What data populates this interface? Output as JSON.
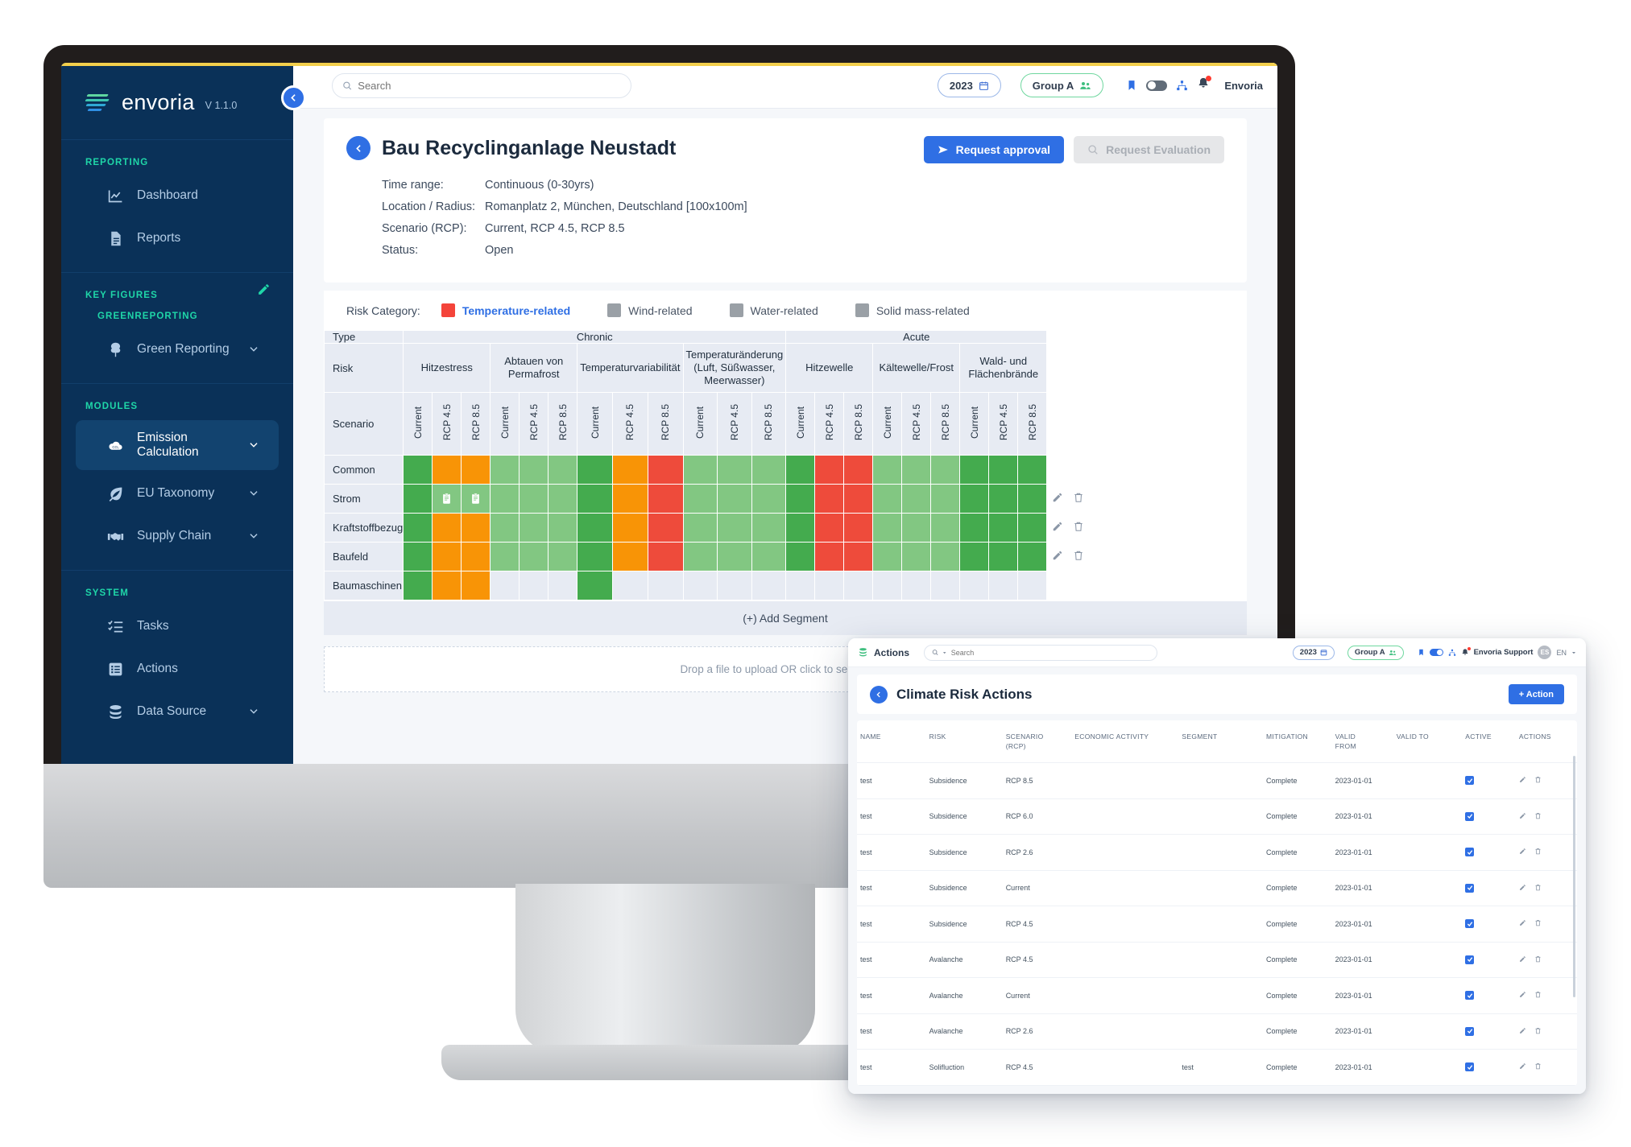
{
  "brand": {
    "name": "envoria",
    "version": "V 1.1.0"
  },
  "sidebar": {
    "groups": [
      {
        "label": "REPORTING",
        "items": [
          {
            "label": "Dashboard",
            "icon": "chart-line-icon"
          },
          {
            "label": "Reports",
            "icon": "document-icon"
          }
        ]
      },
      {
        "label": "KEY FIGURES",
        "sub_label": "GREENREPORTING",
        "edit_icon": "pencil-icon",
        "items": [
          {
            "label": "Green Reporting",
            "icon": "tree-icon",
            "chevron": true
          }
        ]
      },
      {
        "label": "MODULES",
        "items": [
          {
            "label": "Emission Calculation",
            "icon": "co2-cloud-icon",
            "chevron": true,
            "active": true
          },
          {
            "label": "EU Taxonomy",
            "icon": "leaf-icon",
            "chevron": true
          },
          {
            "label": "Supply Chain",
            "icon": "handshake-icon",
            "chevron": true
          }
        ]
      },
      {
        "label": "SYSTEM",
        "items": [
          {
            "label": "Tasks",
            "icon": "checklist-icon"
          },
          {
            "label": "Actions",
            "icon": "list-icon"
          },
          {
            "label": "Data Source",
            "icon": "database-icon",
            "chevron": true
          }
        ]
      }
    ]
  },
  "topbar": {
    "search_placeholder": "Search",
    "year": "2023",
    "group": "Group A",
    "user": "Envoria"
  },
  "page": {
    "title": "Bau Recyclinganlage Neustadt",
    "meta": [
      {
        "key": "Time range:",
        "value": "Continuous (0-30yrs)"
      },
      {
        "key": "Location / Radius:",
        "value": "Romanplatz 2, München, Deutschland [100x100m]"
      },
      {
        "key": "Scenario (RCP):",
        "value": "Current, RCP 4.5, RCP 8.5"
      },
      {
        "key": "Status:",
        "value": "Open"
      }
    ],
    "request_approval": "Request approval",
    "request_evaluation": "Request Evaluation",
    "add_segment": "(+) Add Segment",
    "dropzone": "Drop a file to upload OR click to select a file"
  },
  "legend": {
    "label": "Risk Category:",
    "items": [
      {
        "label": "Temperature-related",
        "color": "#f4443a",
        "selected": true
      },
      {
        "label": "Wind-related",
        "color": "#9aa0a6",
        "selected": false
      },
      {
        "label": "Water-related",
        "color": "#9aa0a6",
        "selected": false
      },
      {
        "label": "Solid mass-related",
        "color": "#9aa0a6",
        "selected": false
      }
    ]
  },
  "matrix": {
    "row_labels": {
      "type": "Type",
      "risk": "Risk",
      "scenario": "Scenario"
    },
    "types": [
      {
        "label": "Chronic",
        "span": 12
      },
      {
        "label": "Acute",
        "span": 9
      }
    ],
    "risks": [
      {
        "label": "Hitzestress",
        "span": 3
      },
      {
        "label": "Abtauen von Permafrost",
        "span": 3
      },
      {
        "label": "Temperaturvariabilität",
        "span": 3
      },
      {
        "label": "Temperaturänderung (Luft, Süßwasser, Meerwasser)",
        "span": 3
      },
      {
        "label": "Hitzewelle",
        "span": 3
      },
      {
        "label": "Kältewelle/Frost",
        "span": 3
      },
      {
        "label": "Wald- und Flächenbrände",
        "span": 3
      }
    ],
    "scenarios": [
      "Current",
      "RCP 4.5",
      "RCP 8.5",
      "Current",
      "RCP 4.5",
      "RCP 8.5",
      "Current",
      "RCP 4.5",
      "RCP 8.5",
      "Current",
      "RCP 4.5",
      "RCP 8.5",
      "Current",
      "RCP 4.5",
      "RCP 8.5",
      "Current",
      "RCP 4.5",
      "RCP 8.5",
      "Current",
      "RCP 4.5",
      "RCP 8.5"
    ],
    "rows": [
      {
        "label": "Common",
        "has_actions": false,
        "cells": [
          "dgreen",
          "orange",
          "orange",
          "lgreen",
          "lgreen",
          "lgreen",
          "dgreen",
          "orange",
          "red",
          "lgreen",
          "lgreen",
          "lgreen",
          "dgreen",
          "red",
          "red",
          "lgreen",
          "lgreen",
          "lgreen",
          "dgreen",
          "dgreen",
          "dgreen"
        ],
        "notes": []
      },
      {
        "label": "Strom",
        "has_actions": true,
        "cells": [
          "dgreen",
          "lgreen",
          "lgreen",
          "lgreen",
          "lgreen",
          "lgreen",
          "dgreen",
          "orange",
          "red",
          "lgreen",
          "lgreen",
          "lgreen",
          "dgreen",
          "red",
          "red",
          "lgreen",
          "lgreen",
          "lgreen",
          "dgreen",
          "dgreen",
          "dgreen"
        ],
        "notes": [
          1,
          2
        ]
      },
      {
        "label": "Kraftstoffbezug",
        "has_actions": true,
        "cells": [
          "dgreen",
          "orange",
          "orange",
          "lgreen",
          "lgreen",
          "lgreen",
          "dgreen",
          "orange",
          "red",
          "lgreen",
          "lgreen",
          "lgreen",
          "dgreen",
          "red",
          "red",
          "lgreen",
          "lgreen",
          "lgreen",
          "dgreen",
          "dgreen",
          "dgreen"
        ],
        "notes": []
      },
      {
        "label": "Baufeld",
        "has_actions": true,
        "cells": [
          "dgreen",
          "orange",
          "orange",
          "lgreen",
          "lgreen",
          "lgreen",
          "dgreen",
          "orange",
          "red",
          "lgreen",
          "lgreen",
          "lgreen",
          "dgreen",
          "red",
          "red",
          "lgreen",
          "lgreen",
          "lgreen",
          "dgreen",
          "dgreen",
          "dgreen"
        ],
        "notes": []
      },
      {
        "label": "Baumaschinen",
        "has_actions": false,
        "cells": [
          "dgreen",
          "orange",
          "orange",
          "empty",
          "empty",
          "empty",
          "dgreen",
          "empty",
          "empty",
          "empty",
          "empty",
          "empty",
          "empty",
          "empty",
          "empty",
          "empty",
          "empty",
          "empty",
          "empty",
          "empty",
          "empty"
        ],
        "notes": []
      }
    ]
  },
  "actions_window": {
    "app_label": "Actions",
    "search_placeholder": "Search",
    "year": "2023",
    "group": "Group A",
    "user": "Envoria Support",
    "avatar_initials": "ES",
    "lang": "EN",
    "title": "Climate Risk Actions",
    "add_button": "+ Action",
    "columns": [
      "NAME",
      "RISK",
      "SCENARIO (RCP)",
      "ECONOMIC ACTIVITY",
      "SEGMENT",
      "MITIGATION",
      "VALID FROM",
      "VALID TO",
      "ACTIVE",
      "ACTIONS"
    ],
    "rows": [
      {
        "name": "test",
        "risk": "Subsidence",
        "scenario": "RCP 8.5",
        "economic_activity": "",
        "segment": "",
        "mitigation": "Complete",
        "valid_from": "2023-01-01",
        "valid_to": "",
        "active": true
      },
      {
        "name": "test",
        "risk": "Subsidence",
        "scenario": "RCP 6.0",
        "economic_activity": "",
        "segment": "",
        "mitigation": "Complete",
        "valid_from": "2023-01-01",
        "valid_to": "",
        "active": true
      },
      {
        "name": "test",
        "risk": "Subsidence",
        "scenario": "RCP 2.6",
        "economic_activity": "",
        "segment": "",
        "mitigation": "Complete",
        "valid_from": "2023-01-01",
        "valid_to": "",
        "active": true
      },
      {
        "name": "test",
        "risk": "Subsidence",
        "scenario": "Current",
        "economic_activity": "",
        "segment": "",
        "mitigation": "Complete",
        "valid_from": "2023-01-01",
        "valid_to": "",
        "active": true
      },
      {
        "name": "test",
        "risk": "Subsidence",
        "scenario": "RCP 4.5",
        "economic_activity": "",
        "segment": "",
        "mitigation": "Complete",
        "valid_from": "2023-01-01",
        "valid_to": "",
        "active": true
      },
      {
        "name": "test",
        "risk": "Avalanche",
        "scenario": "RCP 4.5",
        "economic_activity": "",
        "segment": "",
        "mitigation": "Complete",
        "valid_from": "2023-01-01",
        "valid_to": "",
        "active": true
      },
      {
        "name": "test",
        "risk": "Avalanche",
        "scenario": "Current",
        "economic_activity": "",
        "segment": "",
        "mitigation": "Complete",
        "valid_from": "2023-01-01",
        "valid_to": "",
        "active": true
      },
      {
        "name": "test",
        "risk": "Avalanche",
        "scenario": "RCP 2.6",
        "economic_activity": "",
        "segment": "",
        "mitigation": "Complete",
        "valid_from": "2023-01-01",
        "valid_to": "",
        "active": true
      },
      {
        "name": "test",
        "risk": "Solifluction",
        "scenario": "RCP 4.5",
        "economic_activity": "",
        "segment": "test",
        "mitigation": "Complete",
        "valid_from": "2023-01-01",
        "valid_to": "",
        "active": true
      }
    ]
  }
}
